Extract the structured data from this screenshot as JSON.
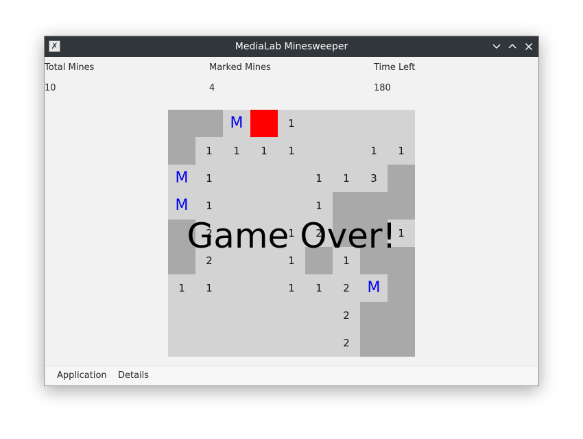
{
  "window": {
    "title": "MediaLab Minesweeper",
    "icon": "x11-app-icon",
    "controls": [
      "minimize",
      "maximize",
      "close"
    ]
  },
  "stats": {
    "total_mines_label": "Total Mines",
    "total_mines_value": "10",
    "marked_mines_label": "Marked Mines",
    "marked_mines_value": "4",
    "time_left_label": "Time Left",
    "time_left_value": "180"
  },
  "board": {
    "rows": 9,
    "cols": 9,
    "colors": {
      "hidden": "#a9a9a9",
      "open": "#d3d3d3",
      "exploded": "#ff0000",
      "flag_text": "#0000ee"
    },
    "legend": "H=hidden, O=open, X=exploded mine, F=flag, digits=open with count",
    "cells": [
      [
        "H",
        "H",
        "F",
        "X",
        "1",
        "O",
        "O",
        "O",
        "O"
      ],
      [
        "H",
        "1",
        "1",
        "1",
        "1",
        "O",
        "O",
        "1",
        "1"
      ],
      [
        "F",
        "1",
        "O",
        "O",
        "O",
        "1",
        "1",
        "3",
        "H"
      ],
      [
        "F",
        "1",
        "O",
        "O",
        "O",
        "1",
        "H",
        "H",
        "H"
      ],
      [
        "H",
        "2",
        "O",
        "O",
        "1",
        "2",
        "H",
        "H",
        "1"
      ],
      [
        "H",
        "2",
        "O",
        "O",
        "1",
        "H",
        "1",
        "H",
        "H"
      ],
      [
        "1",
        "1",
        "O",
        "O",
        "1",
        "1",
        "2",
        "F",
        "H"
      ],
      [
        "O",
        "O",
        "O",
        "O",
        "O",
        "O",
        "2",
        "H",
        "H"
      ],
      [
        "O",
        "O",
        "O",
        "O",
        "O",
        "O",
        "2",
        "H",
        "H"
      ]
    ],
    "flag_text": "M"
  },
  "overlay": {
    "message": "Game Over!"
  },
  "menu": {
    "items": [
      "Application",
      "Details"
    ]
  }
}
